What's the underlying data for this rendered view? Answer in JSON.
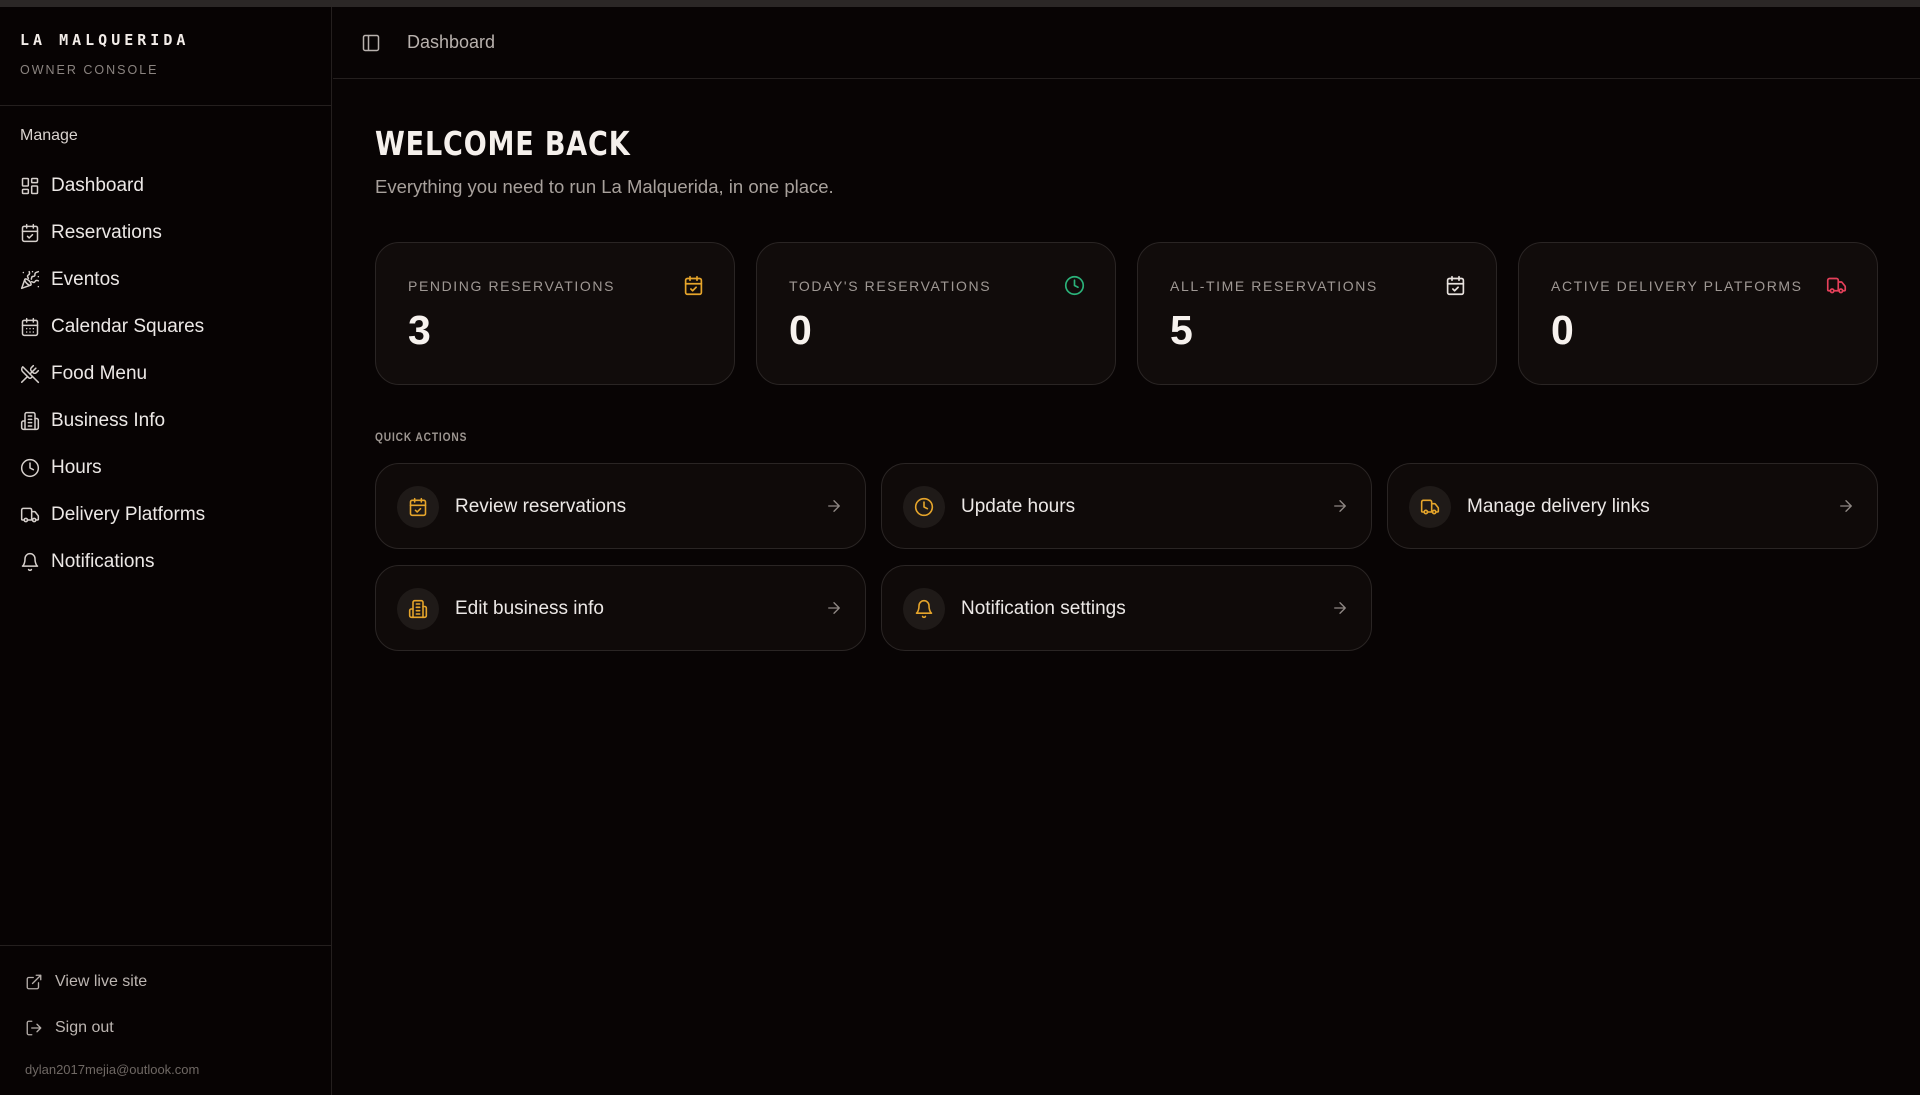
{
  "brand": {
    "title": "LA MALQUERIDA",
    "subtitle": "OWNER CONSOLE"
  },
  "sidebar": {
    "group_label": "Manage",
    "items": [
      {
        "label": "Dashboard",
        "icon": "dashboard-icon"
      },
      {
        "label": "Reservations",
        "icon": "calendar-check-icon"
      },
      {
        "label": "Eventos",
        "icon": "party-popper-icon"
      },
      {
        "label": "Calendar Squares",
        "icon": "calendar-grid-icon"
      },
      {
        "label": "Food Menu",
        "icon": "utensils-icon"
      },
      {
        "label": "Business Info",
        "icon": "building-icon"
      },
      {
        "label": "Hours",
        "icon": "clock-icon"
      },
      {
        "label": "Delivery Platforms",
        "icon": "truck-icon"
      },
      {
        "label": "Notifications",
        "icon": "bell-icon"
      }
    ],
    "footer": {
      "view_live_site": "View live site",
      "sign_out": "Sign out",
      "email": "dylan2017mejia@outlook.com"
    }
  },
  "topbar": {
    "breadcrumb": "Dashboard"
  },
  "main": {
    "title": "WELCOME BACK",
    "subtitle": "Everything you need to run La Malquerida, in one place."
  },
  "stats": [
    {
      "label": "PENDING RESERVATIONS",
      "value": "3",
      "icon": "calendar-check-icon",
      "color": "#e6a52b"
    },
    {
      "label": "TODAY'S RESERVATIONS",
      "value": "0",
      "icon": "clock-icon",
      "color": "#2bb37a"
    },
    {
      "label": "ALL-TIME RESERVATIONS",
      "value": "5",
      "icon": "calendar-check-icon",
      "color": "#e8e2de"
    },
    {
      "label": "ACTIVE DELIVERY PLATFORMS",
      "value": "0",
      "icon": "truck-icon",
      "color": "#e5405a"
    }
  ],
  "quick_actions": {
    "title": "QUICK ACTIONS",
    "items": [
      {
        "label": "Review reservations",
        "icon": "calendar-check-icon"
      },
      {
        "label": "Update hours",
        "icon": "clock-icon"
      },
      {
        "label": "Manage delivery links",
        "icon": "truck-icon"
      },
      {
        "label": "Edit business info",
        "icon": "building-icon"
      },
      {
        "label": "Notification settings",
        "icon": "bell-icon"
      }
    ]
  },
  "colors": {
    "background": "#080404",
    "accent": "#e6a52b"
  }
}
